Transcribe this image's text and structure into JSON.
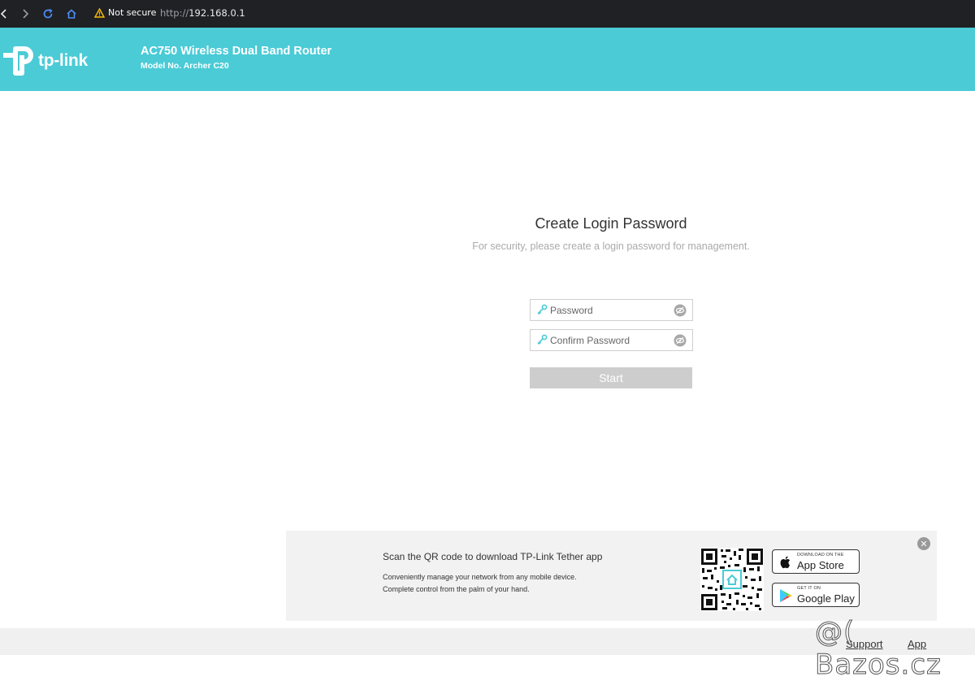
{
  "browser": {
    "security_label": "Not secure",
    "url_scheme": "http://",
    "url_host": "192.168.0.1"
  },
  "header": {
    "logo_text": "tp-link",
    "product_title": "AC750 Wireless Dual Band Router",
    "model_no": "Model No. Archer C20",
    "brand_color": "#4acbd6"
  },
  "login": {
    "title": "Create Login Password",
    "subtitle": "For security, please create a login password for management.",
    "password_placeholder": "Password",
    "confirm_placeholder": "Confirm Password",
    "start_label": "Start"
  },
  "tether": {
    "title": "Scan the QR code to download TP-Link Tether app",
    "desc_line1": "Conveniently manage your network from any mobile device.",
    "desc_line2": "Complete control from the palm of your hand.",
    "app_store_small": "DOWNLOAD ON THE",
    "app_store_big": "App Store",
    "google_play_small": "GET IT ON",
    "google_play_big": "Google Play",
    "close_glyph": "✕"
  },
  "footer": {
    "support_label": "Support",
    "app_label": "App"
  },
  "watermark": "@( Bazos.cz"
}
